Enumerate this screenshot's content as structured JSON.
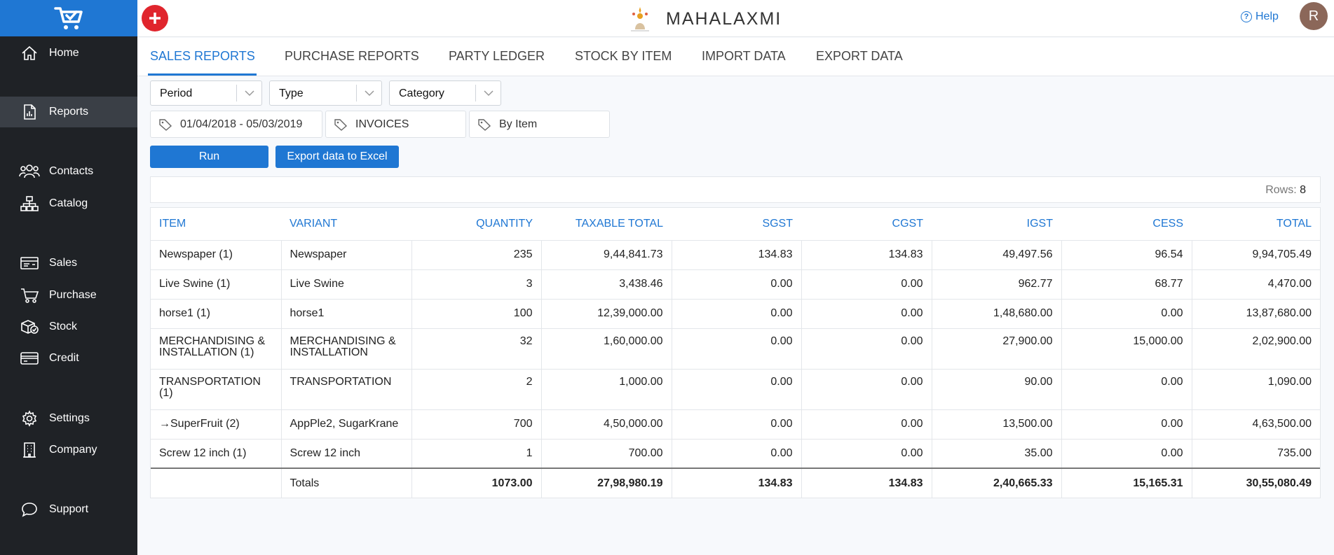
{
  "brand": {
    "name": "MAHALAXMI"
  },
  "topbar": {
    "help_label": "Help",
    "avatar_initial": "R"
  },
  "sidebar": {
    "items": [
      {
        "label": "Home",
        "icon": "home-icon"
      },
      {
        "label": "Reports",
        "icon": "report-icon",
        "active": true
      },
      {
        "label": "Contacts",
        "icon": "contacts-icon"
      },
      {
        "label": "Catalog",
        "icon": "catalog-icon"
      },
      {
        "label": "Sales",
        "icon": "sales-icon"
      },
      {
        "label": "Purchase",
        "icon": "cart-icon"
      },
      {
        "label": "Stock",
        "icon": "stock-icon"
      },
      {
        "label": "Credit",
        "icon": "credit-card-icon"
      },
      {
        "label": "Settings",
        "icon": "gear-icon"
      },
      {
        "label": "Company",
        "icon": "building-icon"
      },
      {
        "label": "Support",
        "icon": "chat-icon"
      }
    ]
  },
  "tabs": [
    {
      "label": "SALES REPORTS",
      "active": true
    },
    {
      "label": "PURCHASE REPORTS"
    },
    {
      "label": "PARTY LEDGER"
    },
    {
      "label": "STOCK BY ITEM"
    },
    {
      "label": "IMPORT DATA"
    },
    {
      "label": "EXPORT DATA"
    }
  ],
  "filters": {
    "selects": [
      "Period",
      "Type",
      "Category"
    ],
    "chips": [
      "01/04/2018 - 05/03/2019",
      "INVOICES",
      "By Item"
    ]
  },
  "actions": {
    "run_label": "Run",
    "export_label": "Export data to Excel"
  },
  "summary": {
    "rows_label": "Rows:",
    "rows_count": "8"
  },
  "table": {
    "headers": [
      "ITEM",
      "VARIANT",
      "QUANTITY",
      "TAXABLE TOTAL",
      "SGST",
      "CGST",
      "IGST",
      "CESS",
      "TOTAL"
    ],
    "rows": [
      [
        "Newspaper (1)",
        "Newspaper",
        "235",
        "9,44,841.73",
        "134.83",
        "134.83",
        "49,497.56",
        "96.54",
        "9,94,705.49"
      ],
      [
        "Live Swine (1)",
        "Live Swine",
        "3",
        "3,438.46",
        "0.00",
        "0.00",
        "962.77",
        "68.77",
        "4,470.00"
      ],
      [
        "horse1 (1)",
        "horse1",
        "100",
        "12,39,000.00",
        "0.00",
        "0.00",
        "1,48,680.00",
        "0.00",
        "13,87,680.00"
      ],
      [
        "MERCHANDISING & INSTALLATION (1)",
        "MERCHANDISING & INSTALLATION",
        "32",
        "1,60,000.00",
        "0.00",
        "0.00",
        "27,900.00",
        "15,000.00",
        "2,02,900.00"
      ],
      [
        "TRANSPORTATION (1)",
        "TRANSPORTATION",
        "2",
        "1,000.00",
        "0.00",
        "0.00",
        "90.00",
        "0.00",
        "1,090.00"
      ],
      [
        "→SuperFruit (2)",
        "AppPle2, SugarKrane",
        "700",
        "4,50,000.00",
        "0.00",
        "0.00",
        "13,500.00",
        "0.00",
        "4,63,500.00"
      ],
      [
        "Screw 12 inch (1)",
        "Screw 12 inch",
        "1",
        "700.00",
        "0.00",
        "0.00",
        "35.00",
        "0.00",
        "735.00"
      ]
    ],
    "totals": [
      "",
      "Totals",
      "1073.00",
      "27,98,980.19",
      "134.83",
      "134.83",
      "2,40,665.33",
      "15,165.31",
      "30,55,080.49"
    ]
  },
  "colors": {
    "accent": "#1f77d3",
    "sidebar": "#1f2226",
    "add_button": "#e0252d"
  }
}
